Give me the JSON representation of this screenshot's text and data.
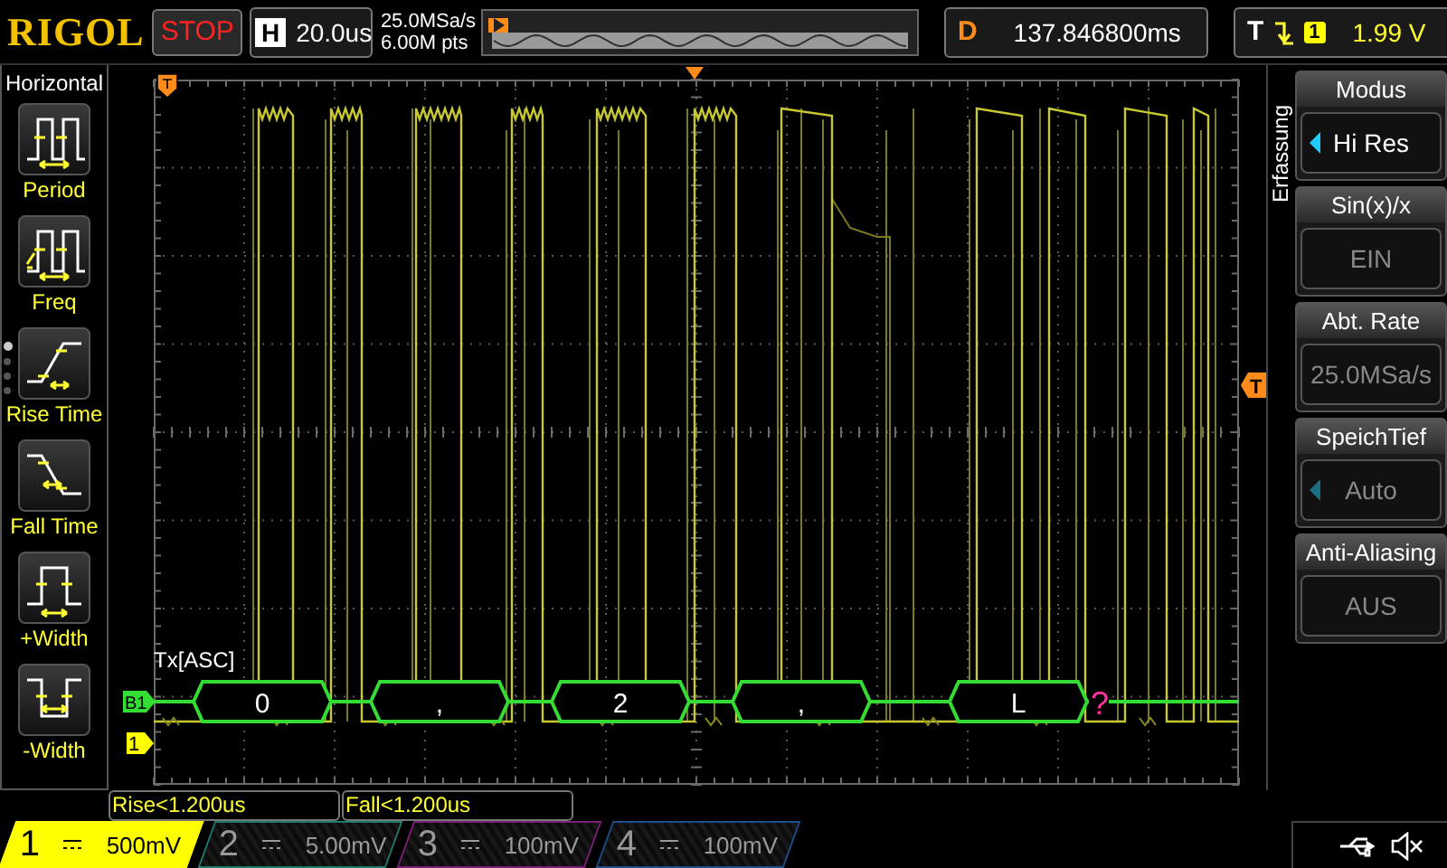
{
  "brand": "RIGOL",
  "run_state": {
    "label": "STOP",
    "kind": "stop"
  },
  "horizontal": {
    "label": "H",
    "timebase": "20.0us"
  },
  "acquisition": {
    "sample_rate": "25.0MSa/s",
    "memory_depth": "6.00M pts"
  },
  "delay": {
    "label": "D",
    "value": "137.846800ms"
  },
  "trigger": {
    "label": "T",
    "source": "1",
    "level": "1.99 V"
  },
  "left_menu": {
    "title": "Horizontal",
    "items": [
      {
        "label": "Period",
        "kind": "period"
      },
      {
        "label": "Freq",
        "kind": "freq"
      },
      {
        "label": "Rise Time",
        "kind": "rise"
      },
      {
        "label": "Fall Time",
        "kind": "fall"
      },
      {
        "label": "+Width",
        "kind": "pwidth"
      },
      {
        "label": "-Width",
        "kind": "nwidth"
      }
    ],
    "pages": [
      {
        "selected": true
      },
      {
        "selected": false
      },
      {
        "selected": false
      },
      {
        "selected": false
      }
    ]
  },
  "plot": {
    "bus_label": "Tx[ASC]",
    "bus_marker": "B1",
    "channel_marker": "1",
    "trigger_level_marker": "T",
    "packets": [
      {
        "text": "0",
        "kind": "data"
      },
      {
        "text": ",",
        "kind": "data"
      },
      {
        "text": "2",
        "kind": "data"
      },
      {
        "text": ",",
        "kind": "data"
      },
      {
        "text": "L",
        "kind": "data"
      },
      {
        "text": "?",
        "kind": "error"
      }
    ]
  },
  "right_menu": {
    "title": "Erfassung",
    "items": [
      {
        "title": "Modus",
        "value": "Hi Res",
        "arrow": true,
        "enabled": true
      },
      {
        "title": "Sin(x)/x",
        "value": "EIN",
        "arrow": false,
        "enabled": false
      },
      {
        "title": "Abt. Rate",
        "value": "25.0MSa/s",
        "arrow": false,
        "enabled": false
      },
      {
        "title": "SpeichTief",
        "value": "Auto",
        "arrow": true,
        "enabled": false
      },
      {
        "title": "Anti-Aliasing",
        "value": "AUS",
        "arrow": false,
        "enabled": false
      }
    ]
  },
  "measurements": [
    {
      "text": "Rise<1.200us"
    },
    {
      "text": "Fall<1.200us"
    }
  ],
  "channels": [
    {
      "number": "1",
      "scale": "500mV",
      "color": "#ffff00",
      "selected": true
    },
    {
      "number": "2",
      "scale": "5.00mV",
      "color": "#1f7a6a",
      "selected": false
    },
    {
      "number": "3",
      "scale": "100mV",
      "color": "#7a1f7a",
      "selected": false
    },
    {
      "number": "4",
      "scale": "100mV",
      "color": "#1f4f8a",
      "selected": false
    }
  ]
}
